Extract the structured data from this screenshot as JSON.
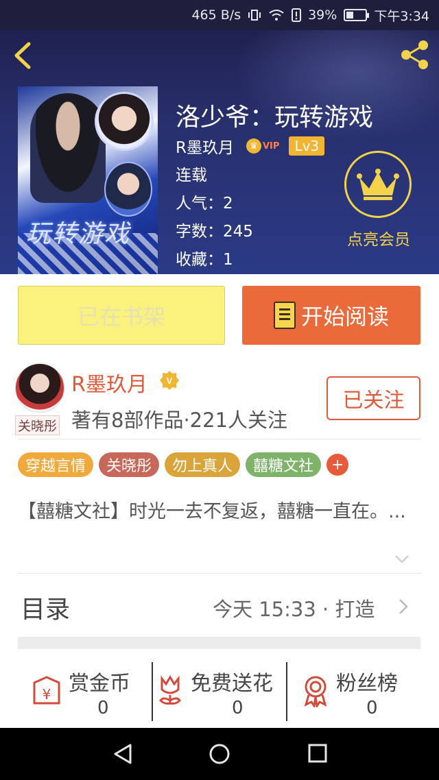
{
  "status_bar": {
    "net_speed": "465 B/s",
    "battery_percent": "39%",
    "battery_level": 0.39,
    "time": "下午3:34",
    "icons": [
      "vibrate-icon",
      "wifi-icon",
      "alert-icon",
      "battery-icon"
    ]
  },
  "book": {
    "title": "洛少爷：玩转游戏",
    "author": "R墨玖月",
    "vip_label": "VIP",
    "level": "Lv3",
    "status": "连载",
    "popularity": "人气：2",
    "word_count": "字数：245",
    "favorites": "收藏：1",
    "cover_title_art": "玩转游戏"
  },
  "member": {
    "label": "点亮会员"
  },
  "actions": {
    "shelf_label": "已在书架",
    "read_label": "开始阅读"
  },
  "author_card": {
    "name": "R墨玖月",
    "avatar_tag": "关晓彤",
    "meta": "著有8部作品·221人关注",
    "follow_label": "已关注"
  },
  "tags": [
    {
      "label": "穿越言情",
      "color": "#f0a93a"
    },
    {
      "label": "关晓彤",
      "color": "#c7685a"
    },
    {
      "label": "勿上真人",
      "color": "#d9a53a"
    },
    {
      "label": "囍糖文社",
      "color": "#7fb36a"
    }
  ],
  "tag_add_label": "+",
  "synopsis": "【囍糖文社】时光一去不复返，囍糖一直在。...",
  "toc": {
    "title": "目录",
    "update": "今天 15:33 · 打造"
  },
  "bottom_stats": [
    {
      "label": "赏金币",
      "count": "0",
      "icon": "coin-envelope-icon"
    },
    {
      "label": "免费送花",
      "count": "0",
      "icon": "flower-icon"
    },
    {
      "label": "粉丝榜",
      "count": "0",
      "icon": "medal-icon"
    }
  ],
  "colors": {
    "accent_orange": "#ea6a3a",
    "accent_yellow": "#f2d34a",
    "shelf_yellow": "#fbf17d",
    "author_red": "#e05a3a"
  }
}
